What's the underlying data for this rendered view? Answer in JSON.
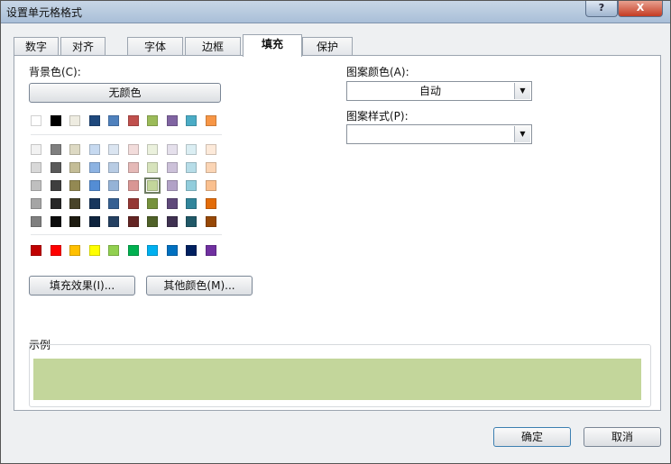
{
  "window": {
    "title": "设置单元格格式",
    "help_label": "?",
    "close_label": "X"
  },
  "tabs": [
    {
      "label": "数字",
      "active": false
    },
    {
      "label": "对齐",
      "active": false
    },
    {
      "label": "字体",
      "active": false
    },
    {
      "label": "边框",
      "active": false
    },
    {
      "label": "填充",
      "active": true
    },
    {
      "label": "保护",
      "active": false
    }
  ],
  "fill": {
    "background_label": "背景色(C):",
    "no_color_label": "无颜色",
    "theme_row": [
      "#ffffff",
      "#000000",
      "#eeece1",
      "#1f497d",
      "#4f81bd",
      "#c0504d",
      "#9bbb59",
      "#8064a2",
      "#4bacc6",
      "#f79646"
    ],
    "shade_rows": [
      [
        "#f2f2f2",
        "#7f7f7f",
        "#ddd9c3",
        "#c6d9f0",
        "#dbe5f1",
        "#f2dcdb",
        "#ebf1dd",
        "#e5e0ec",
        "#dbeef3",
        "#fdeada"
      ],
      [
        "#d8d8d8",
        "#595959",
        "#c4bd97",
        "#8db3e2",
        "#b8cce4",
        "#e5b9b7",
        "#d7e3bc",
        "#ccc1d9",
        "#b7dde8",
        "#fbd5b5"
      ],
      [
        "#bfbfbf",
        "#3f3f3f",
        "#938953",
        "#548dd4",
        "#95b3d7",
        "#d99694",
        "#c3d69b",
        "#b2a2c7",
        "#92cddc",
        "#fac08f"
      ],
      [
        "#a5a5a5",
        "#262626",
        "#494429",
        "#17365d",
        "#366092",
        "#953734",
        "#76923c",
        "#5f497a",
        "#31859b",
        "#e36c09"
      ],
      [
        "#7f7f7f",
        "#0c0c0c",
        "#1d1b10",
        "#0f243e",
        "#244061",
        "#632423",
        "#4f6128",
        "#3f3151",
        "#205867",
        "#974806"
      ]
    ],
    "standard_row": [
      "#c00000",
      "#ff0000",
      "#ffc000",
      "#ffff00",
      "#92d050",
      "#00b050",
      "#00b0f0",
      "#0070c0",
      "#002060",
      "#7030a0"
    ],
    "selected_color": "#c3d69b",
    "fill_effects_label": "填充效果(I)...",
    "more_colors_label": "其他颜色(M)...",
    "pattern_color_label": "图案颜色(A):",
    "pattern_color_value": "自动",
    "pattern_style_label": "图案样式(P):",
    "pattern_style_value": "",
    "sample_label": "示例",
    "sample_color": "#c3d69b"
  },
  "footer": {
    "ok_label": "确定",
    "cancel_label": "取消"
  }
}
